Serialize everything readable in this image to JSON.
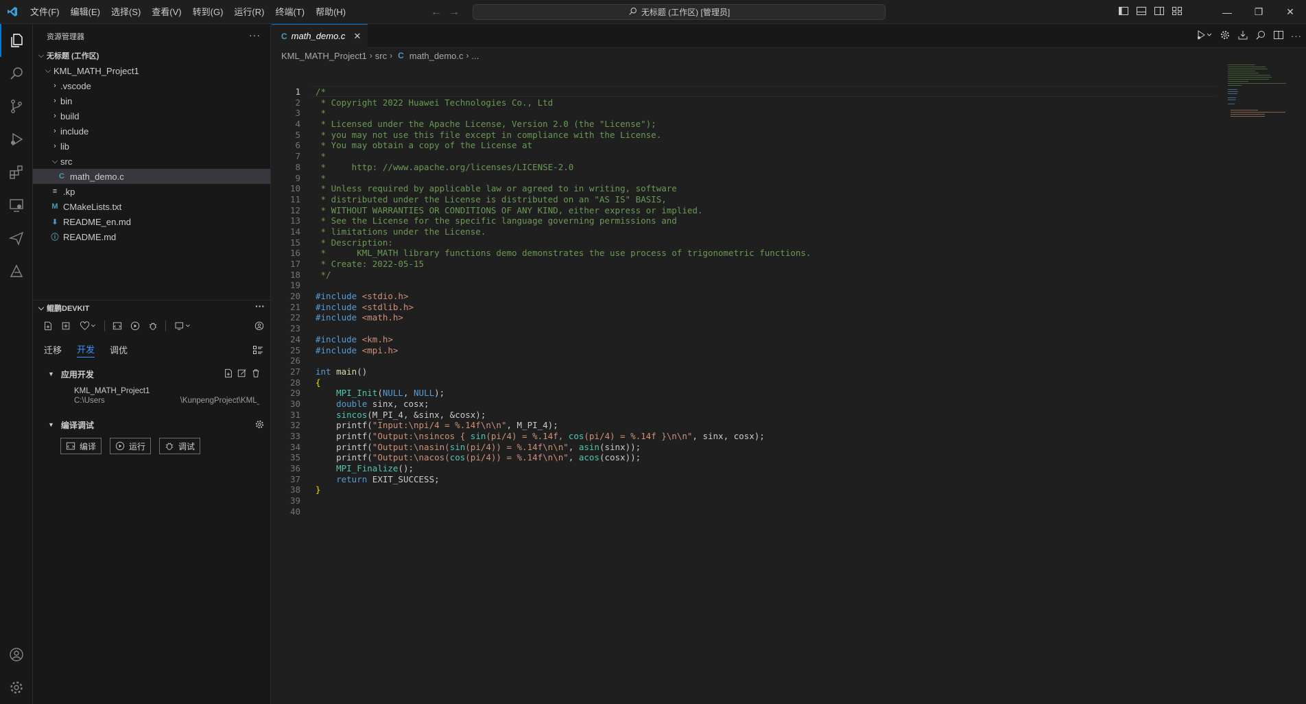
{
  "titlebar": {
    "menu": [
      "文件(F)",
      "编辑(E)",
      "选择(S)",
      "查看(V)",
      "转到(G)",
      "运行(R)",
      "终端(T)",
      "帮助(H)"
    ],
    "command_center": "无标题 (工作区) [管理员]"
  },
  "explorer": {
    "header": "资源管理器",
    "workspace": "无标题 (工作区)",
    "project": "KML_MATH_Project1",
    "items": [
      {
        "label": ".vscode",
        "type": "folder"
      },
      {
        "label": "bin",
        "type": "folder"
      },
      {
        "label": "build",
        "type": "folder"
      },
      {
        "label": "include",
        "type": "folder"
      },
      {
        "label": "lib",
        "type": "folder"
      },
      {
        "label": "src",
        "type": "folder-open"
      },
      {
        "label": "math_demo.c",
        "type": "c-file"
      },
      {
        "label": ".kp",
        "type": "text-file"
      },
      {
        "label": "CMakeLists.txt",
        "type": "cmake-file"
      },
      {
        "label": "README_en.md",
        "type": "md-file"
      },
      {
        "label": "README.md",
        "type": "info-file"
      }
    ]
  },
  "devkit": {
    "header": "鲲鹏DEVKIT",
    "tabs": [
      "迁移",
      "开发",
      "调优"
    ],
    "active_tab": "开发",
    "app_section": "应用开发",
    "project_name": "KML_MATH_Project1",
    "project_path_start": "C:\\Users",
    "project_path_end": "\\KunpengProject\\KML_MATH...",
    "build_section": "编译调试",
    "buttons": {
      "compile": "编译",
      "run": "运行",
      "debug": "调试"
    }
  },
  "editor": {
    "tab_label": "math_demo.c",
    "tab_icon": "C",
    "breadcrumb": [
      "KML_MATH_Project1",
      "src",
      "math_demo.c",
      "..."
    ],
    "current_line": 1,
    "line_count": 40
  },
  "colors": {
    "accent": "#0078d4",
    "comment": "#6a9955",
    "keyword": "#569cd6",
    "string": "#ce9178",
    "function": "#dcdcaa"
  }
}
